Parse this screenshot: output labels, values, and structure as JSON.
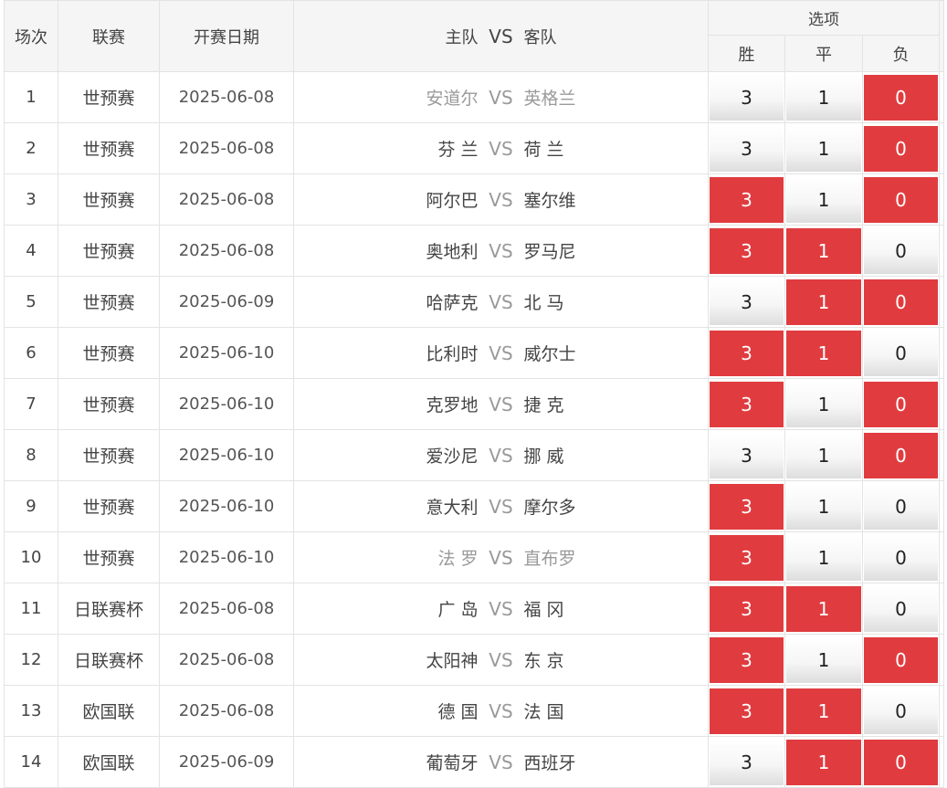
{
  "header": {
    "col_index": "场次",
    "col_league": "联赛",
    "col_date": "开赛日期",
    "col_home": "主队",
    "col_vs": "VS",
    "col_away": "客队",
    "col_options": "选项",
    "opt_win": "胜",
    "opt_draw": "平",
    "opt_lose": "负"
  },
  "colors": {
    "selected": "#e03c3f",
    "selected_text": "#ffffff",
    "dim_team_text": "#9a9a9a"
  },
  "rows": [
    {
      "idx": "1",
      "league": "世预赛",
      "date": "2025-06-08",
      "home": "安道尔",
      "vs": "VS",
      "away": "英格兰",
      "dim": true,
      "win": "3",
      "draw": "1",
      "lose": "0",
      "sel": [
        false,
        false,
        true
      ]
    },
    {
      "idx": "2",
      "league": "世预赛",
      "date": "2025-06-08",
      "home": "芬 兰",
      "vs": "VS",
      "away": "荷 兰",
      "dim": false,
      "win": "3",
      "draw": "1",
      "lose": "0",
      "sel": [
        false,
        false,
        true
      ]
    },
    {
      "idx": "3",
      "league": "世预赛",
      "date": "2025-06-08",
      "home": "阿尔巴",
      "vs": "VS",
      "away": "塞尔维",
      "dim": false,
      "win": "3",
      "draw": "1",
      "lose": "0",
      "sel": [
        true,
        false,
        true
      ]
    },
    {
      "idx": "4",
      "league": "世预赛",
      "date": "2025-06-08",
      "home": "奥地利",
      "vs": "VS",
      "away": "罗马尼",
      "dim": false,
      "win": "3",
      "draw": "1",
      "lose": "0",
      "sel": [
        true,
        true,
        false
      ]
    },
    {
      "idx": "5",
      "league": "世预赛",
      "date": "2025-06-09",
      "home": "哈萨克",
      "vs": "VS",
      "away": "北 马",
      "dim": false,
      "win": "3",
      "draw": "1",
      "lose": "0",
      "sel": [
        false,
        true,
        true
      ]
    },
    {
      "idx": "6",
      "league": "世预赛",
      "date": "2025-06-10",
      "home": "比利时",
      "vs": "VS",
      "away": "威尔士",
      "dim": false,
      "win": "3",
      "draw": "1",
      "lose": "0",
      "sel": [
        true,
        true,
        false
      ]
    },
    {
      "idx": "7",
      "league": "世预赛",
      "date": "2025-06-10",
      "home": "克罗地",
      "vs": "VS",
      "away": "捷 克",
      "dim": false,
      "win": "3",
      "draw": "1",
      "lose": "0",
      "sel": [
        true,
        false,
        true
      ]
    },
    {
      "idx": "8",
      "league": "世预赛",
      "date": "2025-06-10",
      "home": "爱沙尼",
      "vs": "VS",
      "away": "挪 威",
      "dim": false,
      "win": "3",
      "draw": "1",
      "lose": "0",
      "sel": [
        false,
        false,
        true
      ]
    },
    {
      "idx": "9",
      "league": "世预赛",
      "date": "2025-06-10",
      "home": "意大利",
      "vs": "VS",
      "away": "摩尔多",
      "dim": false,
      "win": "3",
      "draw": "1",
      "lose": "0",
      "sel": [
        true,
        false,
        false
      ]
    },
    {
      "idx": "10",
      "league": "世预赛",
      "date": "2025-06-10",
      "home": "法 罗",
      "vs": "VS",
      "away": "直布罗",
      "dim": true,
      "win": "3",
      "draw": "1",
      "lose": "0",
      "sel": [
        true,
        false,
        false
      ]
    },
    {
      "idx": "11",
      "league": "日联赛杯",
      "date": "2025-06-08",
      "home": "广 岛",
      "vs": "VS",
      "away": "福 冈",
      "dim": false,
      "win": "3",
      "draw": "1",
      "lose": "0",
      "sel": [
        true,
        true,
        false
      ]
    },
    {
      "idx": "12",
      "league": "日联赛杯",
      "date": "2025-06-08",
      "home": "太阳神",
      "vs": "VS",
      "away": "东 京",
      "dim": false,
      "win": "3",
      "draw": "1",
      "lose": "0",
      "sel": [
        true,
        false,
        true
      ]
    },
    {
      "idx": "13",
      "league": "欧国联",
      "date": "2025-06-08",
      "home": "德 国",
      "vs": "VS",
      "away": "法 国",
      "dim": false,
      "win": "3",
      "draw": "1",
      "lose": "0",
      "sel": [
        true,
        true,
        false
      ]
    },
    {
      "idx": "14",
      "league": "欧国联",
      "date": "2025-06-09",
      "home": "葡萄牙",
      "vs": "VS",
      "away": "西班牙",
      "dim": false,
      "win": "3",
      "draw": "1",
      "lose": "0",
      "sel": [
        false,
        true,
        true
      ]
    }
  ]
}
